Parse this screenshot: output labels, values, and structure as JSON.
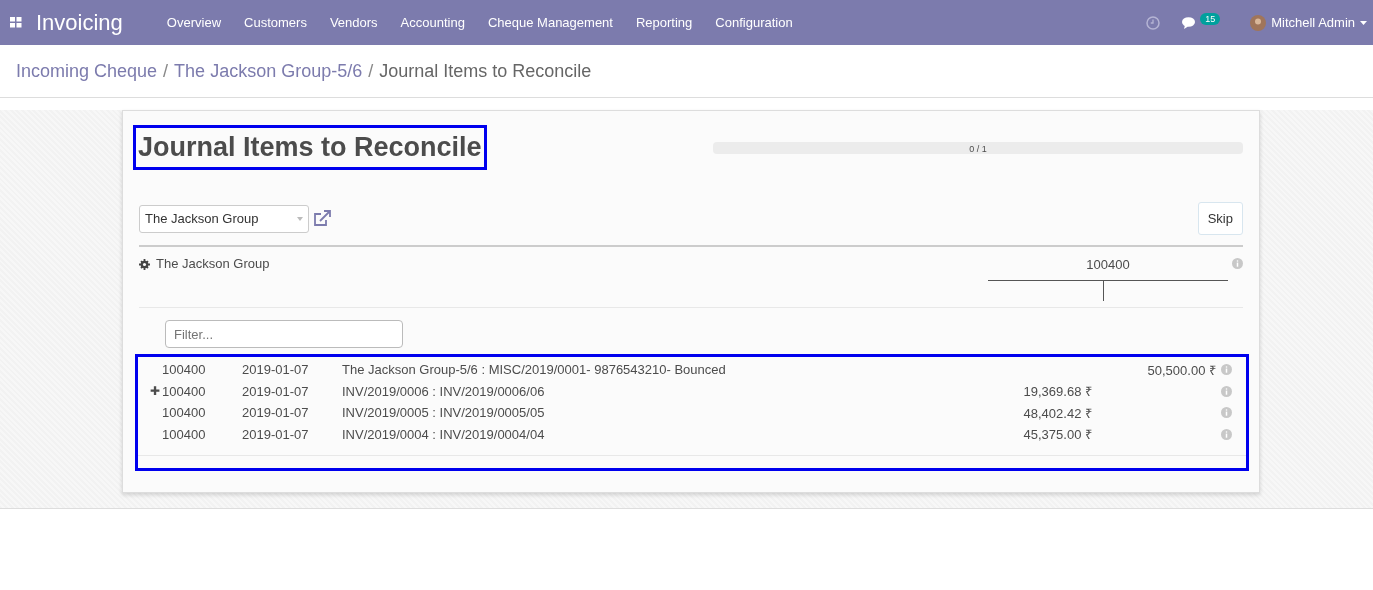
{
  "navbar": {
    "app_title": "Invoicing",
    "menu": [
      "Overview",
      "Customers",
      "Vendors",
      "Accounting",
      "Cheque Management",
      "Reporting",
      "Configuration"
    ],
    "message_count": "15",
    "user": "Mitchell Admin"
  },
  "breadcrumb": [
    {
      "label": "Incoming Cheque",
      "link": true
    },
    {
      "separator": "/",
      "label": "The Jackson Group-5/6",
      "link": true
    },
    {
      "separator": "/",
      "label": "Journal Items to Reconcile",
      "link": false
    }
  ],
  "page": {
    "title": "Journal Items to Reconcile",
    "progress": {
      "level": 0,
      "reading": "0 / 1"
    },
    "partner": "The Jackson Group",
    "skip_button": "Skip"
  },
  "reconcile": {
    "partner": "The Jackson Group",
    "account": "100400",
    "filter_placeholder": "Filter...",
    "rows": [
      {
        "account": "100400",
        "date": "2019-01-07",
        "label": "The Jackson Group-5/6 : MISC/2019/0001- 9876543210- Bounced",
        "credit": "50,500.00 ₹"
      },
      {
        "marker": "✚",
        "account": "100400",
        "date": "2019-01-07",
        "label": "INV/2019/0006 : INV/2019/0006/06",
        "debit": "19,369.68 ₹"
      },
      {
        "account": "100400",
        "date": "2019-01-07",
        "label": "INV/2019/0005 : INV/2019/0005/05",
        "debit": "48,402.42 ₹"
      },
      {
        "account": "100400",
        "date": "2019-01-07",
        "label": "INV/2019/0004 : INV/2019/0004/04",
        "debit": "45,375.00 ₹"
      }
    ]
  }
}
